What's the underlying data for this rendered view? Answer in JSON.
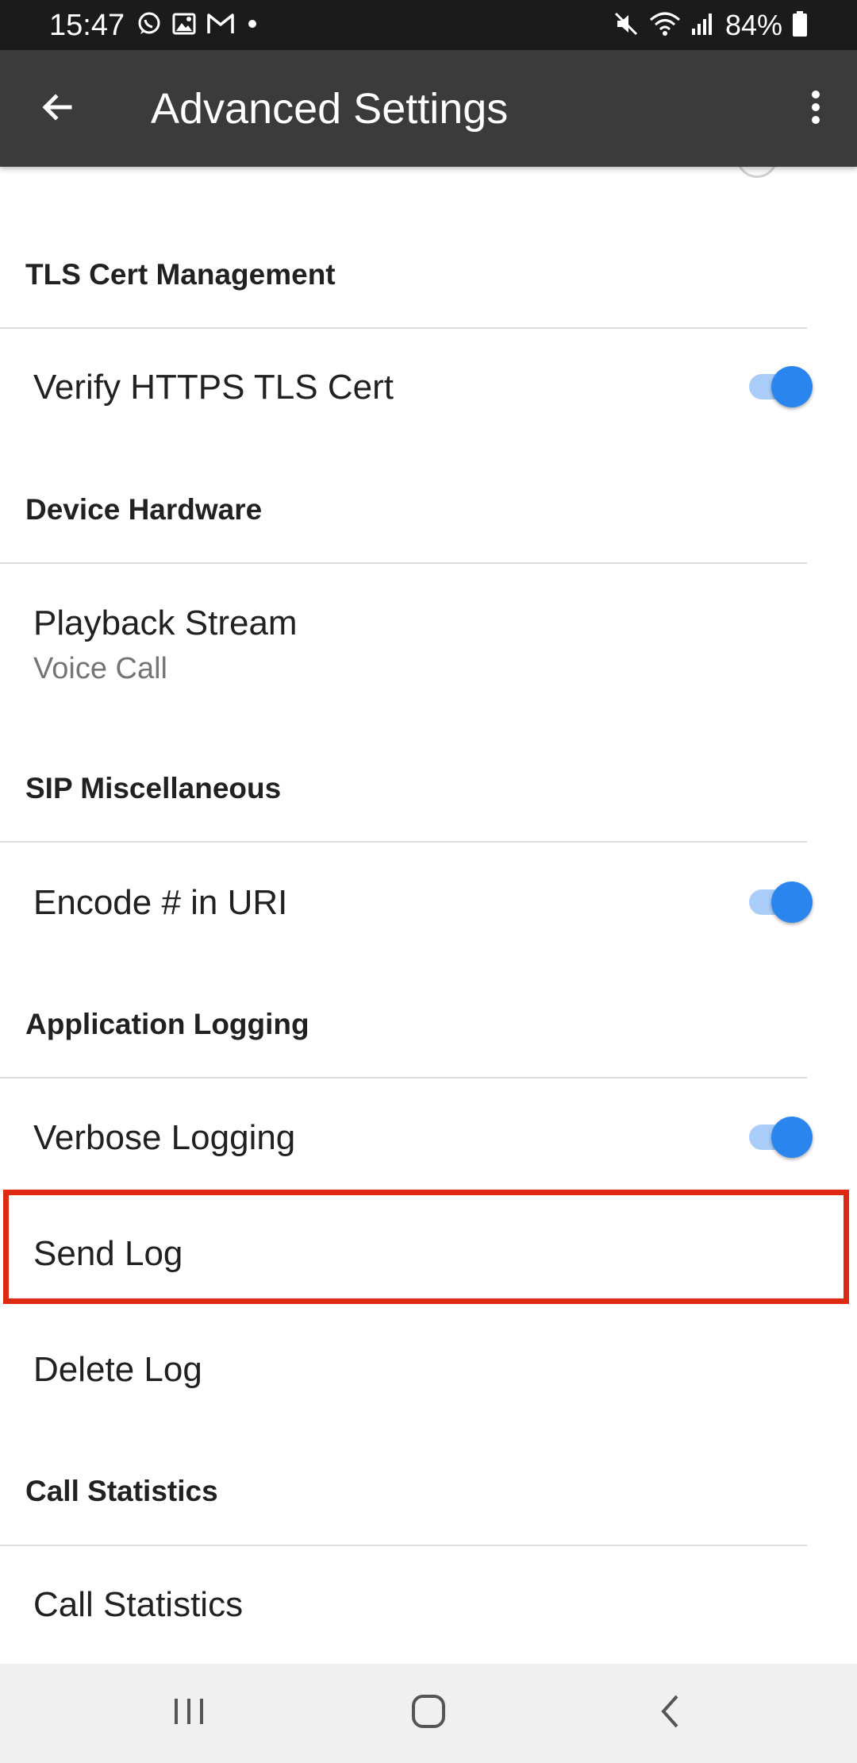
{
  "status_bar": {
    "time": "15:47",
    "battery": "84%",
    "left_icons": [
      "whatsapp-icon",
      "gallery-icon",
      "gmail-icon",
      "dot-icon"
    ],
    "right_icons": [
      "mute-icon",
      "wifi-icon",
      "signal-icon",
      "battery-icon"
    ]
  },
  "app_bar": {
    "title": "Advanced Settings",
    "back_icon": "arrow-left-icon",
    "menu_icon": "more-vert-icon"
  },
  "sections": {
    "tls": {
      "header": "TLS Cert Management",
      "verify_https": {
        "title": "Verify HTTPS TLS Cert",
        "enabled": true
      }
    },
    "device_hardware": {
      "header": "Device Hardware",
      "playback_stream": {
        "title": "Playback Stream",
        "summary": "Voice Call"
      }
    },
    "sip_misc": {
      "header": "SIP Miscellaneous",
      "encode_hash": {
        "title": "Encode # in URI",
        "enabled": true
      }
    },
    "app_logging": {
      "header": "Application Logging",
      "verbose": {
        "title": "Verbose Logging",
        "enabled": true
      },
      "send_log": {
        "title": "Send Log"
      },
      "delete_log": {
        "title": "Delete Log"
      }
    },
    "call_stats": {
      "header": "Call Statistics",
      "call_statistics": {
        "title": "Call Statistics"
      }
    }
  },
  "colors": {
    "accent": "#2a86ee",
    "accent_track": "#a9cdf8",
    "app_bar": "#3b3b3b",
    "status_bar": "#1b1b1b",
    "highlight": "#de2a12"
  },
  "nav_bar": {
    "icons": [
      "recent-apps-icon",
      "home-icon",
      "back-icon"
    ]
  }
}
